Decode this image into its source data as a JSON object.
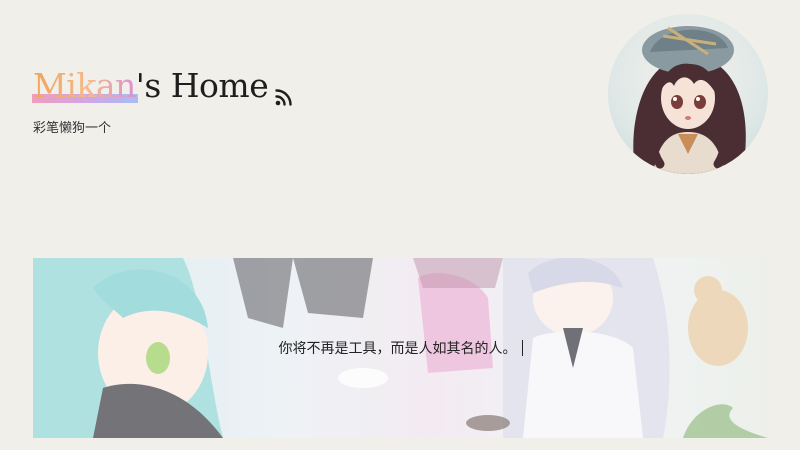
{
  "site": {
    "title_accent": "Mikan",
    "title_rest": "'s Home",
    "subtitle": "彩笔懒狗一个",
    "icons": {
      "feed": "rss-icon"
    }
  },
  "banner": {
    "quote": "你将不再是工具，而是人如其名的人。"
  },
  "colors": {
    "background": "#f1efea",
    "title_text": "#1e1e1e",
    "accent_gradient_start": "#f08fb4",
    "accent_gradient_end": "#9fb3f4"
  }
}
